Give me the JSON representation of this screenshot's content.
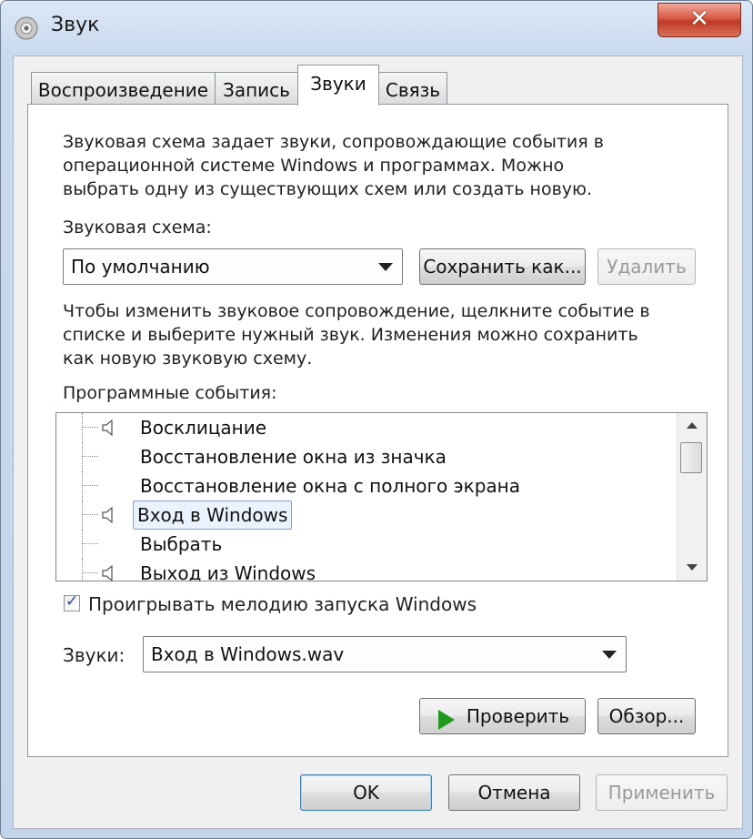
{
  "window": {
    "title": "Звук",
    "close_label": "✕"
  },
  "tabs": [
    {
      "label": "Воспроизведение"
    },
    {
      "label": "Запись"
    },
    {
      "label": "Звуки"
    },
    {
      "label": "Связь"
    }
  ],
  "description": [
    "Звуковая схема задает звуки, сопровождающие события в",
    "операционной системе Windows и программах. Можно",
    "выбрать одну из существующих схем или создать новую."
  ],
  "scheme": {
    "label": "Звуковая схема:",
    "value": "По умолчанию",
    "save_button": "Сохранить как...",
    "delete_button": "Удалить"
  },
  "instructions": [
    "Чтобы изменить звуковое сопровождение, щелкните событие в",
    "списке и выберите нужный звук. Изменения можно сохранить",
    "как новую звуковую схему."
  ],
  "events": {
    "label": "Программные события:",
    "items": [
      {
        "label": "Восклицание",
        "has_sound": true
      },
      {
        "label": "Восстановление окна из значка",
        "has_sound": false
      },
      {
        "label": "Восстановление окна с полного экрана",
        "has_sound": false
      },
      {
        "label": "Вход в Windows",
        "has_sound": true,
        "selected": true
      },
      {
        "label": "Выбрать",
        "has_sound": false
      },
      {
        "label": "Выход из Windows",
        "has_sound": true
      }
    ]
  },
  "startup_checkbox": {
    "label": "Проигрывать мелодию запуска Windows",
    "checked": true
  },
  "sounds": {
    "label": "Звуки:",
    "value": "Вход в Windows.wav",
    "test_button": "Проверить",
    "browse_button": "Обзор..."
  },
  "footer": {
    "ok": "OK",
    "cancel": "Отмена",
    "apply": "Применить"
  }
}
